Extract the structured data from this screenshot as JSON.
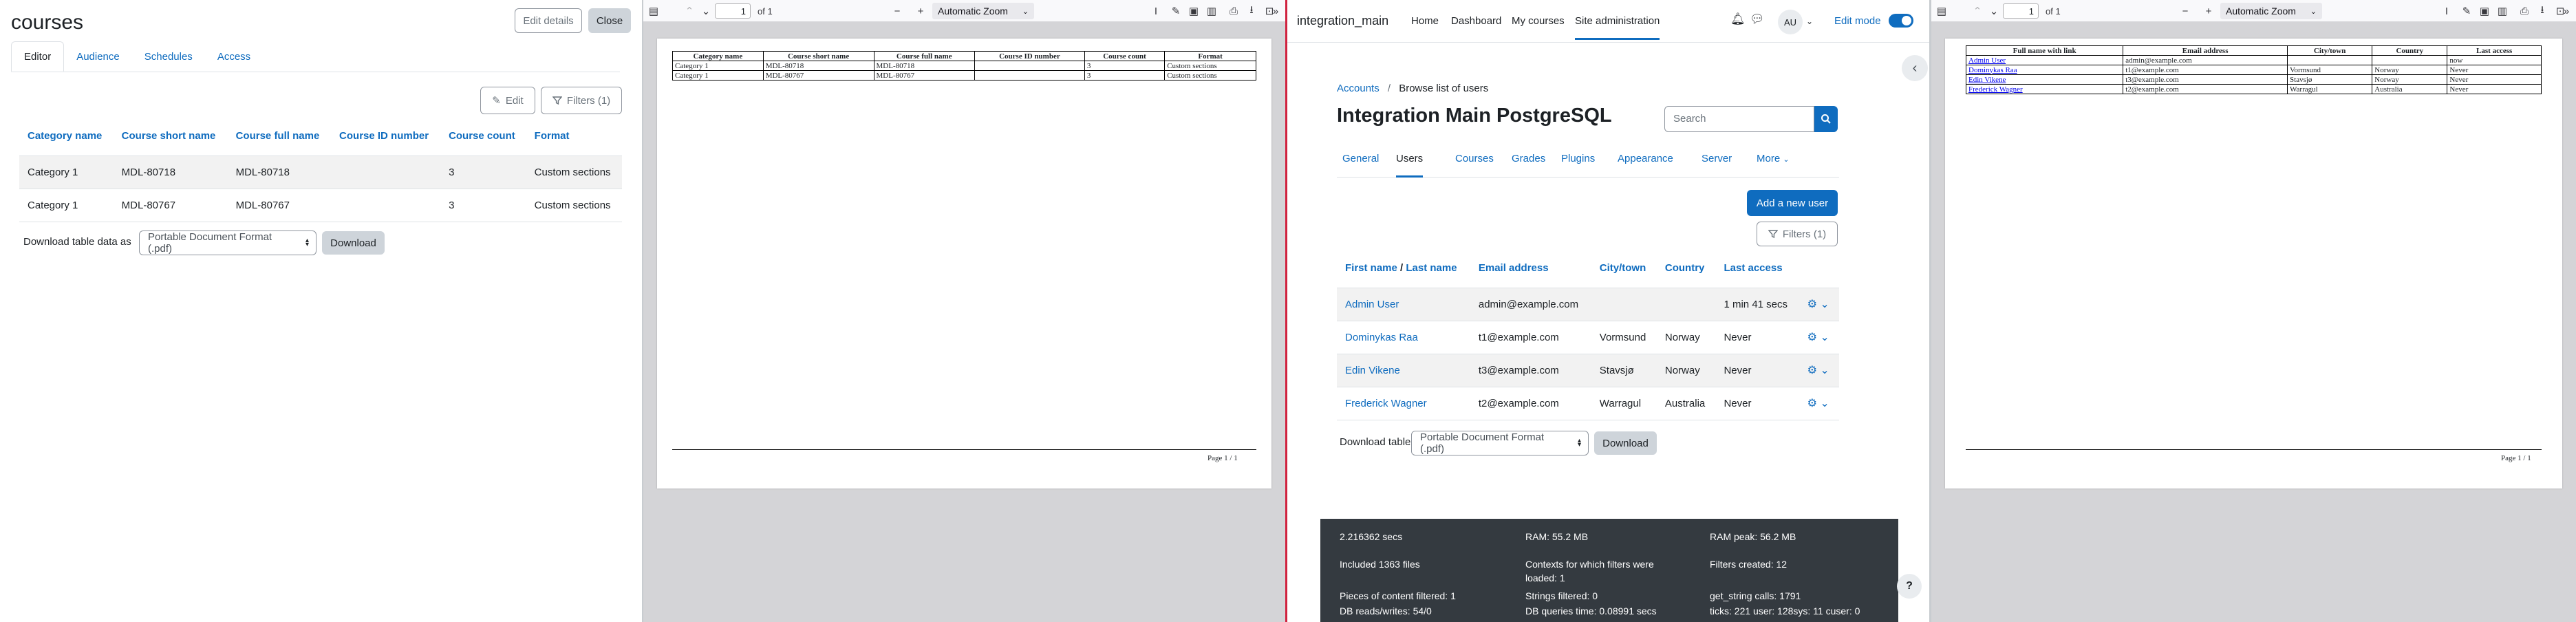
{
  "course_pane": {
    "title": "courses",
    "edit_details_label": "Edit details",
    "close_label": "Close",
    "tabs": [
      "Editor",
      "Audience",
      "Schedules",
      "Access"
    ],
    "edit_label": "Edit",
    "filters_label": "Filters (1)",
    "columns": [
      "Category name",
      "Course short name",
      "Course full name",
      "Course ID number",
      "Course count",
      "Format"
    ],
    "rows": [
      [
        "Category 1",
        "MDL-80718",
        "MDL-80718",
        "",
        "3",
        "Custom sections"
      ],
      [
        "Category 1",
        "MDL-80767",
        "MDL-80767",
        "",
        "3",
        "Custom sections"
      ]
    ],
    "download_label": "Download table data as",
    "download_format": "Portable Document Format (.pdf)",
    "download_button": "Download"
  },
  "pdf_viewer_1": {
    "page_number": "1",
    "page_count": "of 1",
    "zoom": "Automatic Zoom",
    "columns": [
      "Category name",
      "Course short name",
      "Course full name",
      "Course ID number",
      "Course count",
      "Format"
    ],
    "rows": [
      [
        "Category 1",
        "MDL-80718",
        "MDL-80718",
        "",
        "3",
        "Custom sections"
      ],
      [
        "Category 1",
        "MDL-80767",
        "MDL-80767",
        "",
        "3",
        "Custom sections"
      ]
    ],
    "footer": "Page 1 / 1"
  },
  "users_pane": {
    "site_name": "integration_main",
    "nav": [
      "Home",
      "Dashboard",
      "My courses",
      "Site administration"
    ],
    "avatar_initials": "AU",
    "edit_mode_label": "Edit mode",
    "breadcrumb": [
      "Accounts",
      "Browse list of users"
    ],
    "heading": "Integration Main PostgreSQL",
    "search_placeholder": "Search",
    "tabs": [
      "General",
      "Users",
      "Courses",
      "Grades",
      "Plugins",
      "Appearance",
      "Server",
      "More"
    ],
    "add_user_label": "Add a new user",
    "filters_label": "Filters (1)",
    "col_first": "First name",
    "col_sep": " / ",
    "col_last": "Last name",
    "columns": [
      "Email address",
      "City/town",
      "Country",
      "Last access"
    ],
    "rows": [
      [
        "Admin User",
        "admin@example.com",
        "",
        "",
        "1 min 41 secs"
      ],
      [
        "Dominykas Raa",
        "t1@example.com",
        "Vormsund",
        "Norway",
        "Never"
      ],
      [
        "Edin Vikene",
        "t3@example.com",
        "Stavsjø",
        "Norway",
        "Never"
      ],
      [
        "Frederick Wagner",
        "t2@example.com",
        "Warragul",
        "Australia",
        "Never"
      ]
    ],
    "download_label": "Download table data as",
    "download_format": "Portable Document Format (.pdf)",
    "download_button": "Download",
    "perf": {
      "time": "2.216362 secs",
      "ram": "RAM: 55.2 MB",
      "ram_peak": "RAM peak: 56.2 MB",
      "files": "Included 1363 files",
      "contexts_1": "Contexts for which filters were",
      "contexts_2": "loaded: 1",
      "filters_created": "Filters created: 12",
      "content_filtered": "Pieces of content filtered: 1",
      "strings_filtered": "Strings filtered: 0",
      "get_string": "get_string calls: 1791",
      "db_rw": "DB reads/writes: 54/0",
      "db_time": "DB queries time: 0.08991 secs",
      "ticks": "ticks: 221 user: 128sys: 11 cuser: 0"
    },
    "help_label": "?"
  },
  "pdf_viewer_2": {
    "page_number": "1",
    "page_count": "of 1",
    "zoom": "Automatic Zoom",
    "columns": [
      "Full name with link",
      "Email address",
      "City/town",
      "Country",
      "Last access"
    ],
    "rows": [
      [
        "Admin User",
        "admin@example.com",
        "",
        "",
        "now"
      ],
      [
        "Dominykas Raa",
        "t1@example.com",
        "Vormsund",
        "Norway",
        "Never"
      ],
      [
        "Edin Vikene",
        "t3@example.com",
        "Stavsjø",
        "Norway",
        "Never"
      ],
      [
        "Frederick Wagner",
        "t2@example.com",
        "Warragul",
        "Australia",
        "Never"
      ]
    ],
    "footer": "Page 1 / 1"
  }
}
